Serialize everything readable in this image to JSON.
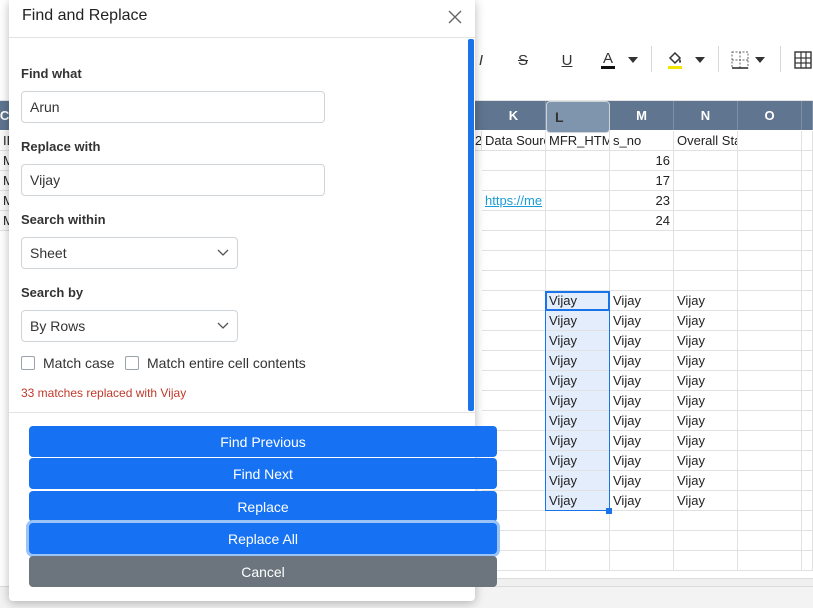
{
  "dialog": {
    "title": "Find and Replace",
    "find_label": "Find what",
    "find_value": "Arun",
    "replace_label": "Replace with",
    "replace_value": "Vijay",
    "within_label": "Search within",
    "within_value": "Sheet",
    "by_label": "Search by",
    "by_value": "By Rows",
    "match_case": "Match case",
    "match_entire": "Match entire cell contents",
    "status": "33 matches replaced with Vijay",
    "buttons": {
      "find_previous": "Find Previous",
      "find_next": "Find Next",
      "replace": "Replace",
      "replace_all": "Replace All",
      "cancel": "Cancel"
    }
  },
  "toolbar": {
    "italic": "I",
    "strike": "S",
    "underline": "U",
    "font_color": "A"
  },
  "sheet": {
    "columns": [
      "K",
      "L",
      "M",
      "N",
      "O"
    ],
    "left_col": "C",
    "left_cells": [
      "ID",
      "M",
      "M",
      "M",
      "M"
    ],
    "header_row": {
      "K": "Data Source",
      "L": "MFR_HTML",
      "M": "s_no",
      "N": "Overall Status"
    },
    "k_partial_prefix": "2",
    "sno": [
      "16",
      "17",
      "23",
      "24"
    ],
    "link": "https://me",
    "value": "Vijay"
  },
  "colors": {
    "header_bg": "#5f7590",
    "primary": "#1672f3",
    "secondary": "#6c757d",
    "status": "#c0392b"
  }
}
